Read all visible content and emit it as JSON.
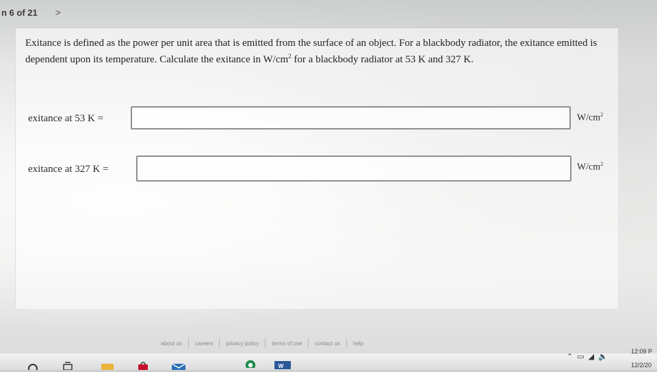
{
  "nav": {
    "counter": "n 6 of 21",
    "next_glyph": ">"
  },
  "question": {
    "text_before_unit": "Exitance is defined as the power per unit area that is emitted from the surface of an object. For a blackbody radiator, the exitance emitted is dependent upon its temperature. Calculate the exitance in W/cm",
    "unit_exponent": "2",
    "text_after_unit": " for a blackbody radiator at 53 K and 327 K."
  },
  "answers": [
    {
      "label": "exitance at 53 K =",
      "value": "",
      "unit_base": "W/cm",
      "unit_exp": "2"
    },
    {
      "label": "exitance at 327 K =",
      "value": "",
      "unit_base": "W/cm",
      "unit_exp": "2"
    }
  ],
  "footer": {
    "links": [
      "about us",
      "careers",
      "privacy policy",
      "terms of use",
      "contact us",
      "help"
    ]
  },
  "taskbar": {
    "time": "12:09 P",
    "date": "12/2/20",
    "tray_icons": [
      "chevron-up-icon",
      "network-icon",
      "wifi-icon",
      "volume-icon"
    ],
    "app_icons": [
      "search-icon",
      "task-view-icon",
      "file-explorer-icon",
      "store-icon",
      "mail-icon",
      "chrome-icon",
      "word-icon"
    ]
  }
}
